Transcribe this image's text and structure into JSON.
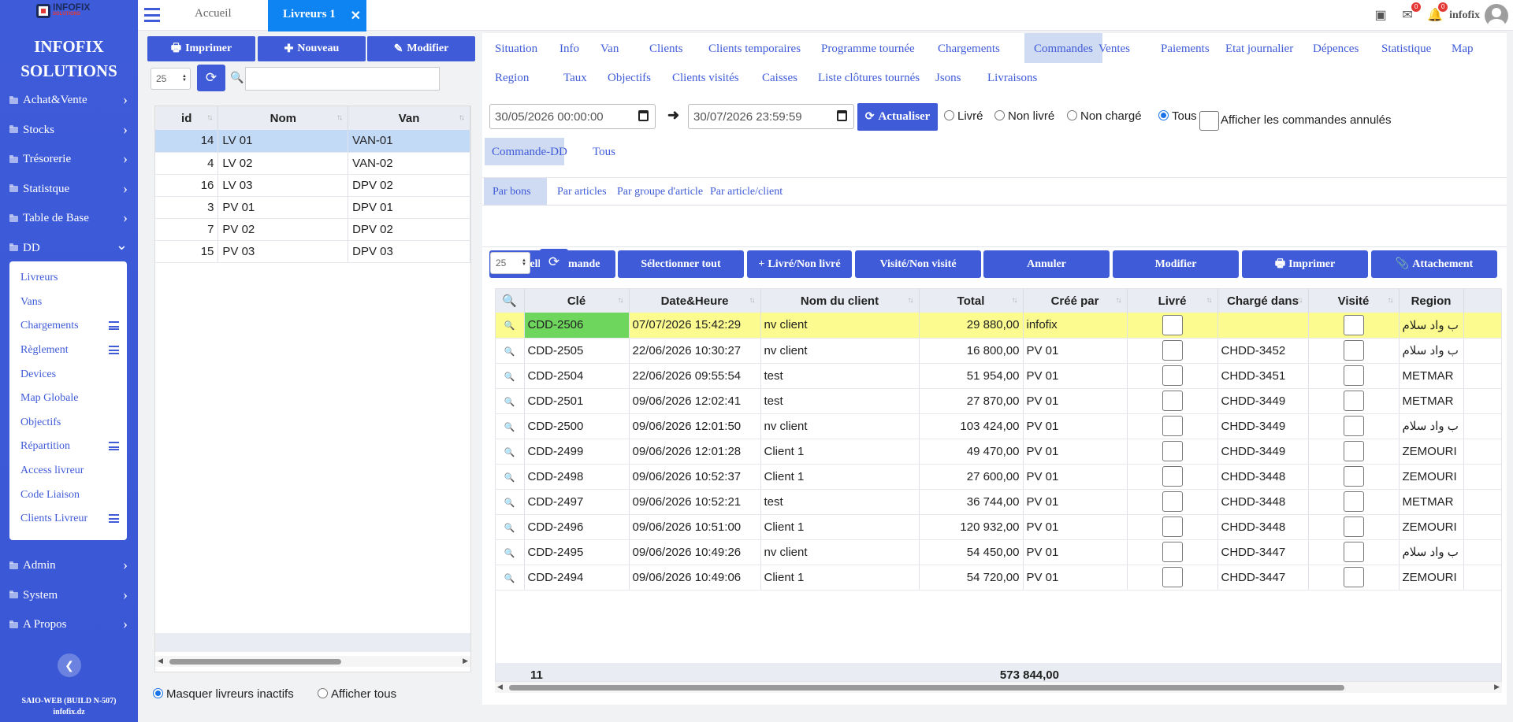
{
  "sidebar": {
    "logo_text": "INFOFIX",
    "logo_sub": "SOLUTIONS",
    "brand_line1": "INFOFIX",
    "brand_line2": "SOLUTIONS",
    "items": [
      {
        "label": "Achat&Vente"
      },
      {
        "label": "Stocks"
      },
      {
        "label": "Trésorerie"
      },
      {
        "label": "Statistque"
      },
      {
        "label": "Table de Base"
      },
      {
        "label": "DD"
      }
    ],
    "sub_items": [
      {
        "label": "Livreurs",
        "menu": false
      },
      {
        "label": "Vans",
        "menu": false
      },
      {
        "label": "Chargements",
        "menu": true
      },
      {
        "label": "Règlement",
        "menu": true
      },
      {
        "label": "Devices",
        "menu": false
      },
      {
        "label": "Map Globale",
        "menu": false
      },
      {
        "label": "Objectifs",
        "menu": false
      },
      {
        "label": "Répartition",
        "menu": true
      },
      {
        "label": "Access livreur",
        "menu": false
      },
      {
        "label": "Code Liaison",
        "menu": false
      },
      {
        "label": "Clients Livreur",
        "menu": true
      }
    ],
    "bottom_items": [
      {
        "label": "Admin"
      },
      {
        "label": "System"
      },
      {
        "label": "A Propos"
      }
    ],
    "build_line1": "SAIO-WEB (BUILD N-507)",
    "build_line2": "infofix.dz"
  },
  "topbar": {
    "home_tab": "Accueil",
    "active_tab": "Livreurs 1",
    "close_glyph": "✕",
    "badge_messages": "0",
    "badge_notifications": "0",
    "user": "infofix"
  },
  "left": {
    "print_label": "Imprimer",
    "new_label": "Nouveau",
    "edit_label": "Modifier",
    "page_size": "25",
    "search_value": "",
    "columns": [
      "id",
      "Nom",
      "Van"
    ],
    "rows": [
      {
        "id": "14",
        "nom": "LV 01",
        "van": "VAN-01",
        "selected": true
      },
      {
        "id": "4",
        "nom": "LV 02",
        "van": "VAN-02"
      },
      {
        "id": "16",
        "nom": "LV 03",
        "van": "DPV 02"
      },
      {
        "id": "3",
        "nom": "PV 01",
        "van": "DPV 01"
      },
      {
        "id": "7",
        "nom": "PV 02",
        "van": "DPV 02"
      },
      {
        "id": "15",
        "nom": "PV 03",
        "van": "DPV 03"
      }
    ],
    "opt_hide_inactive": "Masquer livreurs inactifs",
    "opt_show_all": "Afficher tous"
  },
  "right": {
    "tabs_row1": [
      "Situation",
      "Info",
      "Van",
      "Clients",
      "Clients temporaires",
      "Programme tournée",
      "Chargements",
      "Commandes",
      "Ventes",
      "Paiements",
      "Etat journalier",
      "Dépences",
      "Statistique",
      "Map"
    ],
    "tabs_row2": [
      "Region",
      "Taux",
      "Objectifs",
      "Clients visités",
      "Caisses",
      "Liste clôtures tournés",
      "Jsons",
      "Livraisons"
    ],
    "active_tab": "Commandes",
    "date_from": "30/05/2026 00:00:00",
    "date_to": "30/07/2026 23:59:59",
    "refresh_label": "Actualiser",
    "filters": [
      "Livré",
      "Non livré",
      "Non chargé",
      "Tous"
    ],
    "filter_selected": "Tous",
    "show_cancelled": "Afficher les commandes annulés",
    "subtabs": [
      "Commande-DD",
      "Tous"
    ],
    "viewtabs": [
      "Par bons",
      "Par articles",
      "Par groupe d'article",
      "Par article/client"
    ],
    "actions": [
      {
        "label": "Nouvelle commande",
        "icon": ""
      },
      {
        "label": "Sélectionner tout",
        "icon": ""
      },
      {
        "label": "Livré/Non livré",
        "icon": "+"
      },
      {
        "label": "Visité/Non visité",
        "icon": ""
      },
      {
        "label": "Annuler",
        "icon": ""
      },
      {
        "label": "Modifier",
        "icon": ""
      },
      {
        "label": "Imprimer",
        "icon": "🖶"
      },
      {
        "label": "Attachement",
        "icon": "📎"
      }
    ],
    "page_size": "25",
    "columns": [
      "Clé",
      "Date&Heure",
      "Nom du client",
      "Total",
      "Créé par",
      "Livré",
      "Chargé dans",
      "Visité",
      "Region"
    ],
    "rows": [
      {
        "cle": "CDD-2506",
        "date": "07/07/2026 15:42:29",
        "client": "nv client",
        "total": "29 880,00",
        "cree": "infofix",
        "charge": "",
        "region": "ب واد سلام",
        "highlight": true
      },
      {
        "cle": "CDD-2505",
        "date": "22/06/2026 10:30:27",
        "client": "nv client",
        "total": "16 800,00",
        "cree": "PV 01",
        "charge": "CHDD-3452",
        "region": "ب واد سلام"
      },
      {
        "cle": "CDD-2504",
        "date": "22/06/2026 09:55:54",
        "client": "test",
        "total": "51 954,00",
        "cree": "PV 01",
        "charge": "CHDD-3451",
        "region": "METMAR"
      },
      {
        "cle": "CDD-2501",
        "date": "09/06/2026 12:02:41",
        "client": "test",
        "total": "27 870,00",
        "cree": "PV 01",
        "charge": "CHDD-3449",
        "region": "METMAR"
      },
      {
        "cle": "CDD-2500",
        "date": "09/06/2026 12:01:50",
        "client": "nv client",
        "total": "103 424,00",
        "cree": "PV 01",
        "charge": "CHDD-3449",
        "region": "ب واد سلام"
      },
      {
        "cle": "CDD-2499",
        "date": "09/06/2026 12:01:28",
        "client": "Client 1",
        "total": "49 470,00",
        "cree": "PV 01",
        "charge": "CHDD-3449",
        "region": "ZEMOURI"
      },
      {
        "cle": "CDD-2498",
        "date": "09/06/2026 10:52:37",
        "client": "Client 1",
        "total": "27 600,00",
        "cree": "PV 01",
        "charge": "CHDD-3448",
        "region": "ZEMOURI"
      },
      {
        "cle": "CDD-2497",
        "date": "09/06/2026 10:52:21",
        "client": "test",
        "total": "36 744,00",
        "cree": "PV 01",
        "charge": "CHDD-3448",
        "region": "METMAR"
      },
      {
        "cle": "CDD-2496",
        "date": "09/06/2026 10:51:00",
        "client": "Client 1",
        "total": "120 932,00",
        "cree": "PV 01",
        "charge": "CHDD-3448",
        "region": "ZEMOURI"
      },
      {
        "cle": "CDD-2495",
        "date": "09/06/2026 10:49:26",
        "client": "nv client",
        "total": "54 450,00",
        "cree": "PV 01",
        "charge": "CHDD-3447",
        "region": "ب واد سلام"
      },
      {
        "cle": "CDD-2494",
        "date": "09/06/2026 10:49:06",
        "client": "Client 1",
        "total": "54 720,00",
        "cree": "PV 01",
        "charge": "CHDD-3447",
        "region": "ZEMOURI"
      }
    ],
    "footer_count": "11",
    "footer_total": "573 844,00"
  }
}
